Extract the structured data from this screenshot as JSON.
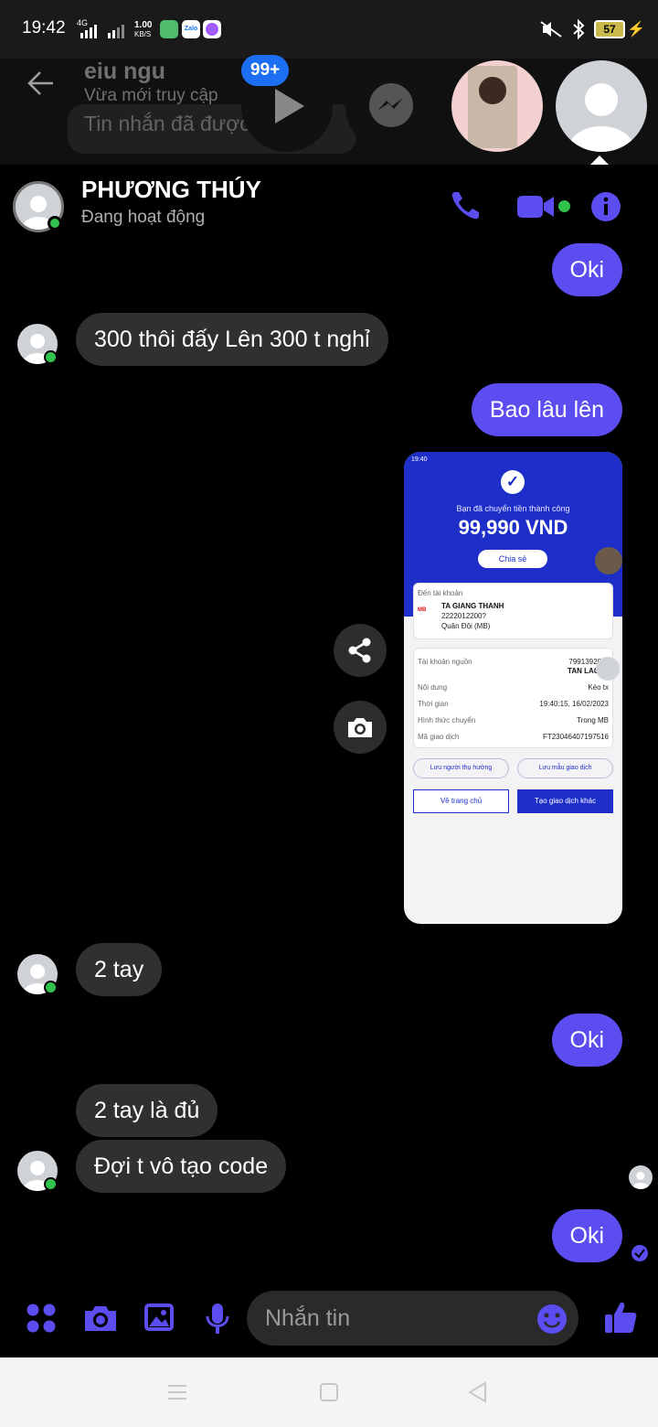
{
  "status_bar": {
    "time": "19:42",
    "network": "4G",
    "speed_top": "1.00",
    "speed_bottom": "KB/S",
    "app_zalo": "Zalo",
    "battery": "57"
  },
  "background_chat": {
    "name": "eiu ngu",
    "status": "Vừa mới truy cập",
    "preview": "Tin nhắn đã được ... ồi"
  },
  "chat_heads": {
    "badge": "99+"
  },
  "header": {
    "name": "PHƯƠNG THÚY",
    "status": "Đang hoạt động"
  },
  "messages": [
    {
      "dir": "out",
      "text": "Oki"
    },
    {
      "dir": "in",
      "text": "300 thôi đấy Lên 300 t nghỉ"
    },
    {
      "dir": "out",
      "text": "Bao lâu lên"
    },
    {
      "dir": "out-image",
      "text": ""
    },
    {
      "dir": "in",
      "text": "2 tay"
    },
    {
      "dir": "out",
      "text": "Oki"
    },
    {
      "dir": "in",
      "text": "2 tay là đủ"
    },
    {
      "dir": "in",
      "text": "Đợi t vô tạo code"
    },
    {
      "dir": "out",
      "text": "Oki"
    }
  ],
  "receipt": {
    "status_time": "19:40",
    "headline": "Bạn đã chuyển tiền thành công",
    "amount": "99,990 VND",
    "share": "Chia sẻ",
    "to_label": "Đến tài khoản",
    "bank_code": "MB",
    "to_name": "TA GIANG THANH",
    "to_account": "2222012200?",
    "to_bank": "Quân Đội (MB)",
    "rows": [
      {
        "label": "Tài khoản nguồn",
        "value": "79913920…"
      },
      {
        "label": "",
        "value": "TAN LAO"
      },
      {
        "label": "Nội dung",
        "value": "Kéo tx"
      },
      {
        "label": "Thời gian",
        "value": "19:40:15, 16/02/2023"
      },
      {
        "label": "Hình thức chuyển",
        "value": "Trong MB"
      },
      {
        "label": "Mã giao dịch",
        "value": "FT23046407197516"
      }
    ],
    "btn_save_beneficiary": "Lưu người thụ hưởng",
    "btn_save_template": "Lưu mẫu giao dịch",
    "btn_home": "Về trang chủ",
    "btn_new": "Tạo giao dịch khác"
  },
  "composer": {
    "placeholder": "Nhắn tin"
  },
  "colors": {
    "accent": "#5b4df0",
    "online": "#31c24d",
    "incoming_bubble": "#303030"
  }
}
